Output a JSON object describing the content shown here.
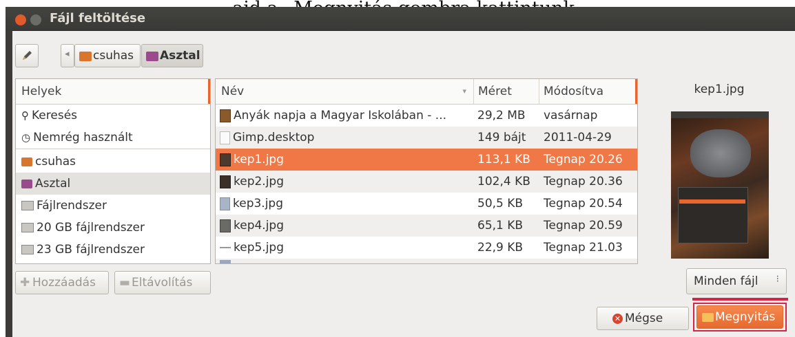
{
  "caption": "...ajd a „Megnyitás gombra kattintunk.",
  "window": {
    "title": "Fájl feltöltése"
  },
  "toolbar": {
    "crumbs": [
      "csuhas",
      "Asztal"
    ]
  },
  "places": {
    "header": "Helyek",
    "items": [
      {
        "label": "Keresés",
        "icon": "search-icon"
      },
      {
        "label": "Nemrég használt",
        "icon": "clock-icon"
      },
      {
        "label": "csuhas",
        "icon": "home-folder-icon"
      },
      {
        "label": "Asztal",
        "icon": "desktop-icon"
      },
      {
        "label": "Fájlrendszer",
        "icon": "drive-icon"
      },
      {
        "label": "20 GB fájlrendszer",
        "icon": "drive-icon"
      },
      {
        "label": "23 GB fájlrendszer",
        "icon": "drive-icon"
      }
    ],
    "selected": "Asztal",
    "add_label": "Hozzáadás",
    "remove_label": "Eltávolítás"
  },
  "files": {
    "columns": {
      "name": "Név",
      "size": "Méret",
      "modified": "Módosítva"
    },
    "rows": [
      {
        "name": "Anyák napja a Magyar Iskolában - ...",
        "size": "29,2 MB",
        "modified": "vasárnap",
        "icon": "video-icon"
      },
      {
        "name": "Gimp.desktop",
        "size": "149 bájt",
        "modified": "2011-04-29",
        "icon": "document-icon"
      },
      {
        "name": "kep1.jpg",
        "size": "113,1 KB",
        "modified": "Tegnap 20.26",
        "icon": "image-icon"
      },
      {
        "name": "kep2.jpg",
        "size": "102,4 KB",
        "modified": "Tegnap 20.36",
        "icon": "image-icon"
      },
      {
        "name": "kep3.jpg",
        "size": "50,5 KB",
        "modified": "Tegnap 20.54",
        "icon": "image-icon"
      },
      {
        "name": "kep4.jpg",
        "size": "65,1 KB",
        "modified": "Tegnap 20.59",
        "icon": "image-icon"
      },
      {
        "name": "kep5.jpg",
        "size": "22,9 KB",
        "modified": "Tegnap 21.03",
        "icon": "image-icon"
      }
    ],
    "selected": "kep1.jpg"
  },
  "preview": {
    "filename": "kep1.jpg"
  },
  "filter": {
    "selected": "Minden fájl"
  },
  "buttons": {
    "cancel": "Mégse",
    "open": "Megnyitás"
  },
  "colors": {
    "accent": "#f07746",
    "highlight_box": "#d82444",
    "titlebar": "#3c3b37"
  }
}
